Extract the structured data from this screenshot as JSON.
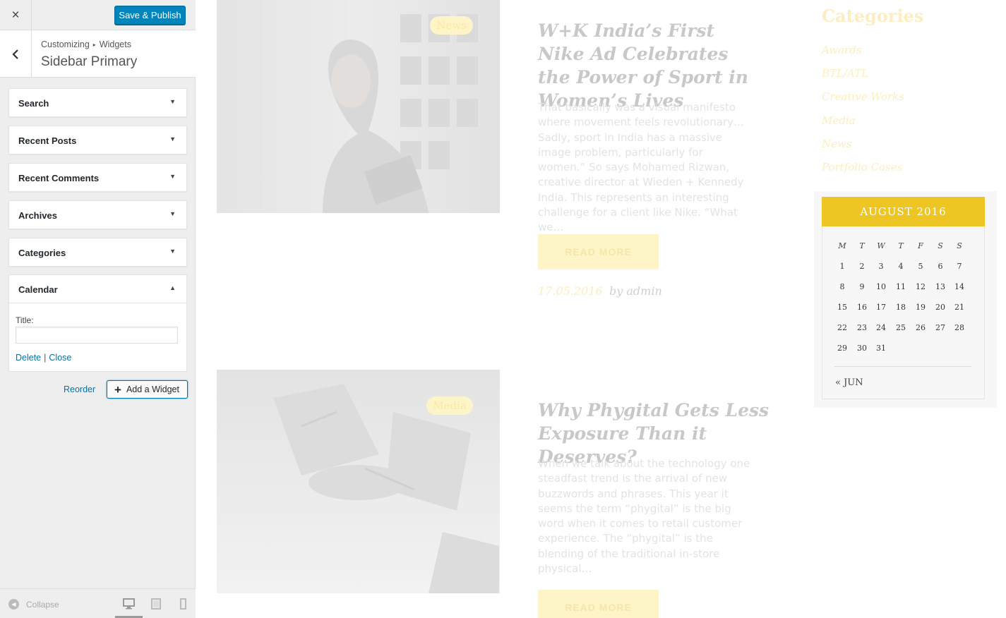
{
  "customizer": {
    "close_label": "×",
    "publish_label": "Save & Publish",
    "breadcrumb": {
      "parent": "Customizing",
      "separator": "▸",
      "child": "Widgets"
    },
    "section_title": "Sidebar Primary",
    "widgets": [
      {
        "title": "Search",
        "expanded": false
      },
      {
        "title": "Recent Posts",
        "expanded": false
      },
      {
        "title": "Recent Comments",
        "expanded": false
      },
      {
        "title": "Archives",
        "expanded": false
      },
      {
        "title": "Categories",
        "expanded": false
      }
    ],
    "calendar_widget": {
      "title": "Calendar",
      "field_label": "Title:",
      "field_value": "",
      "delete_label": "Delete",
      "separator": "|",
      "close_label": "Close"
    },
    "reorder_label": "Reorder",
    "add_widget_label": "Add a Widget",
    "collapse_label": "Collapse",
    "active_device": "desktop"
  },
  "preview": {
    "posts": [
      {
        "badge": "News",
        "title": "W+K India’s First Nike Ad Celebrates the Power of Sport in Women’s Lives",
        "excerpt": "That basically was a visual manifesto where movement feels revolutionary… Sadly, sport in India has a massive image problem, particularly for women.” So says Mohamed Rizwan, creative director at Wieden + Kennedy India. This represents an interesting challenge for a client like Nike. “What we…",
        "read_more": "READ MORE",
        "date": "17.05.2016",
        "author": "by admin"
      },
      {
        "badge": "Media",
        "title": "Why Phygital Gets Less Exposure Than it Deserves?",
        "excerpt": "When we talk about the technology one steadfast trend is the arrival of new buzzwords and phrases. This year it seems the term “phygital” is the big word when it comes to retail customer experience. The “phygital” is the blending of the traditional in-store physical…",
        "read_more": "READ MORE"
      }
    ],
    "categories": {
      "heading": "Categories",
      "items": [
        "Awards",
        "BTL/ATL",
        "Creative Works",
        "Media",
        "News",
        "Portfolio Cases"
      ]
    },
    "calendar": {
      "caption": "AUGUST 2016",
      "weekdays": [
        "M",
        "T",
        "W",
        "T",
        "F",
        "S",
        "S"
      ],
      "weeks": [
        [
          "1",
          "2",
          "3",
          "4",
          "5",
          "6",
          "7"
        ],
        [
          "8",
          "9",
          "10",
          "11",
          "12",
          "13",
          "14"
        ],
        [
          "15",
          "16",
          "17",
          "18",
          "19",
          "20",
          "21"
        ],
        [
          "22",
          "23",
          "24",
          "25",
          "26",
          "27",
          "28"
        ],
        [
          "29",
          "30",
          "31",
          "",
          "",
          "",
          ""
        ]
      ],
      "prev_label": "« JUN"
    }
  },
  "colors": {
    "publish": "#0085ba",
    "link": "#0073aa",
    "calendar_header": "#eec624",
    "badge_bg": "#fdf4c7"
  }
}
